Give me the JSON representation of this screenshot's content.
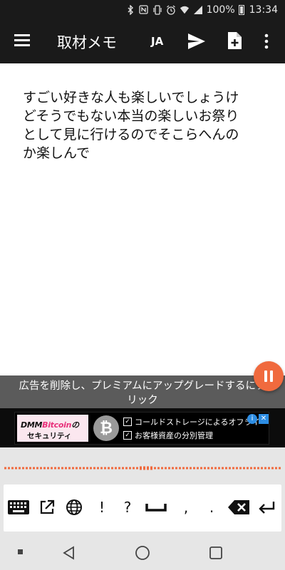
{
  "status_bar": {
    "battery_text": "100%",
    "time": "13:34",
    "icons": [
      "bluetooth-icon",
      "nfc-icon",
      "vibrate-icon",
      "alarm-icon",
      "wifi-icon",
      "signal-icon",
      "battery-icon"
    ]
  },
  "app_bar": {
    "title": "取材メモ",
    "language": "JA",
    "icons": [
      "menu-icon",
      "send-icon",
      "add-note-icon",
      "more-vert-icon"
    ]
  },
  "note": {
    "lines": [
      "すごい好きな人も楽しいでしょうけ",
      "どそうでもない本当の楽しいお祭り",
      "として見に行けるのでそこらへんの",
      "か楽しんで"
    ]
  },
  "upgrade_banner": {
    "line1": "広告を削除し、プレミアムにアップグレードするにク",
    "line2": "リック"
  },
  "ad": {
    "logo_brand": "DMM",
    "logo_highlight": "Bitcoin",
    "logo_suffix": "の",
    "logo_sub": "セキュリティ",
    "coin_symbol": "₿",
    "line1": "コールドストレージによるオフライ",
    "line2": "お客様資産の分別管理",
    "colors": {
      "accent": "#e8307a",
      "info": "#2d8de3"
    }
  },
  "keyboard": {
    "keys": [
      "keyboard-icon",
      "open-external-icon",
      "globe-icon",
      "!",
      "?",
      "space-icon",
      ",",
      ".",
      "backspace-icon",
      "enter-icon"
    ],
    "exclaim": "!",
    "question": "?",
    "comma": ",",
    "period": "."
  },
  "theme": {
    "appbar_bg": "#1a1a1a",
    "fab_color": "#f06a3e",
    "waveform_color": "#f06a3e",
    "banner_bg": "#5b5b5b"
  }
}
